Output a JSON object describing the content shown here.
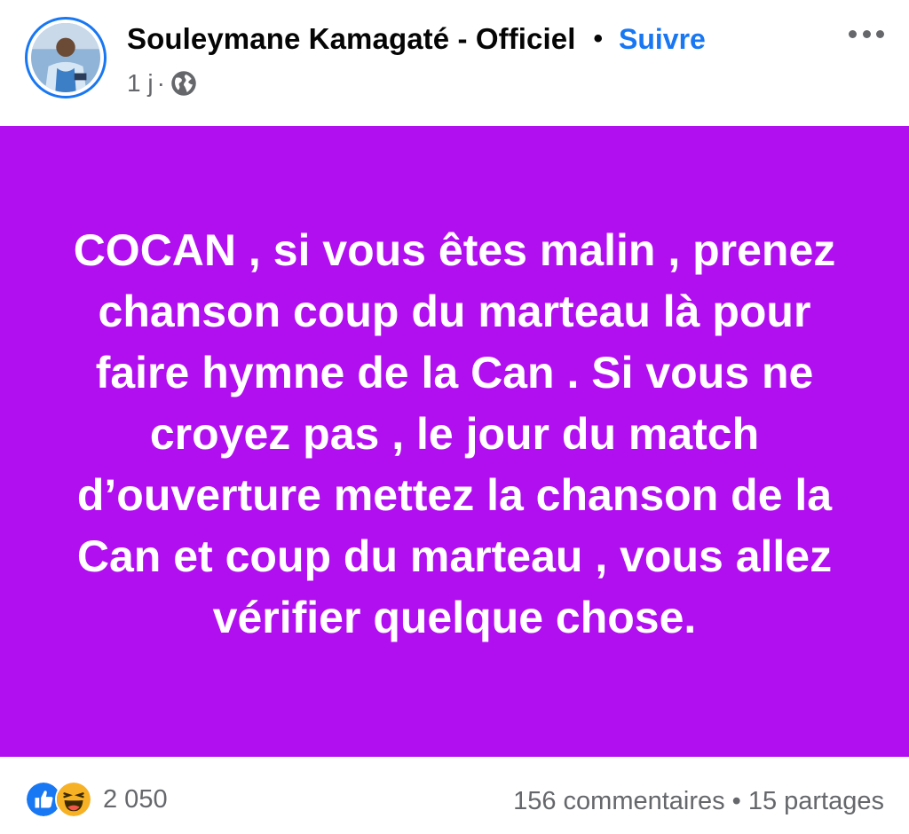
{
  "post": {
    "author": {
      "name": "Souleymane Kamagaté - Officiel",
      "follow_label": "Suivre",
      "separator": "•"
    },
    "meta": {
      "time": "1 j",
      "separator": "·",
      "privacy_icon": "globe-icon"
    },
    "more_icon": "more-horizontal-icon",
    "status": {
      "background_color": "#b20ff0",
      "text": "COCAN , si vous êtes malin , prenez chanson coup du marteau là pour faire hymne de la Can . Si vous ne croyez pas , le jour du match d’ouverture mettez la chanson de la Can et coup du marteau , vous allez vérifier quelque chose."
    },
    "footer": {
      "reaction_icons": [
        "like-icon",
        "haha-icon"
      ],
      "reaction_count": "2 050",
      "comments": "156 commentaires",
      "separator": "•",
      "shares": "15 partages"
    }
  }
}
